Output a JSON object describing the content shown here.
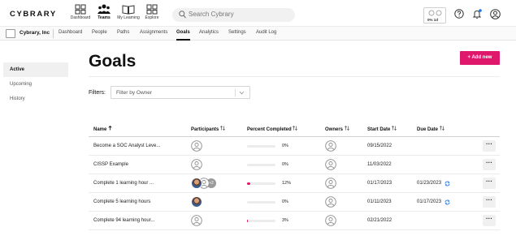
{
  "brand": {
    "logo_text": "CYBRARY",
    "accent_color": "#e0186c"
  },
  "header": {
    "nav": [
      {
        "label": "Dashboard",
        "icon": "dashboard-grid-icon",
        "active": false
      },
      {
        "label": "Teams",
        "icon": "teams-people-icon",
        "active": true
      },
      {
        "label": "My Learning",
        "icon": "book-icon",
        "active": false
      },
      {
        "label": "Explore",
        "icon": "explore-grid-icon",
        "active": false
      }
    ],
    "search": {
      "placeholder": "Search Cybrary"
    },
    "stats": {
      "text": "0% 1d"
    },
    "icons": [
      "help-icon",
      "notifications-bell-icon",
      "user-avatar-icon"
    ]
  },
  "subnav": {
    "org_name": "Cybrary, Inc",
    "tabs": [
      {
        "label": "Dashboard",
        "active": false
      },
      {
        "label": "People",
        "active": false
      },
      {
        "label": "Paths",
        "active": false
      },
      {
        "label": "Assignments",
        "active": false
      },
      {
        "label": "Goals",
        "active": true
      },
      {
        "label": "Analytics",
        "active": false
      },
      {
        "label": "Settings",
        "active": false
      },
      {
        "label": "Audit Log",
        "active": false
      }
    ]
  },
  "sidebar": {
    "items": [
      {
        "label": "Active",
        "active": true
      },
      {
        "label": "Upcoming",
        "active": false
      },
      {
        "label": "History",
        "active": false
      }
    ]
  },
  "page": {
    "title": "Goals",
    "add_button": "+ Add new",
    "filter": {
      "label": "Filters:",
      "placeholder": "Filter by Owner"
    }
  },
  "table": {
    "columns": [
      "Name",
      "Participants",
      "Percent Completed",
      "Owners",
      "Start Date",
      "Due Date"
    ],
    "rows": [
      {
        "name": "Become a SOC Analyst Leve...",
        "participants": [
          "empty"
        ],
        "percent": 0,
        "percent_text": "0%",
        "start": "09/15/2022",
        "due": "",
        "recurring": false
      },
      {
        "name": "CISSP Example",
        "participants": [
          "empty"
        ],
        "percent": 0,
        "percent_text": "0%",
        "start": "11/03/2022",
        "due": "",
        "recurring": false
      },
      {
        "name": "Complete 1 learning hour ...",
        "participants": [
          "photo",
          "empty",
          "more"
        ],
        "more_text": "+2",
        "percent": 12,
        "percent_text": "12%",
        "start": "01/17/2023",
        "due": "01/23/2023",
        "recurring": true
      },
      {
        "name": "Complete 5 learning hours",
        "participants": [
          "photo"
        ],
        "percent": 0,
        "percent_text": "0%",
        "start": "01/11/2023",
        "due": "01/17/2023",
        "recurring": true
      },
      {
        "name": "Complete 94 learning hour...",
        "participants": [
          "empty"
        ],
        "percent": 3,
        "percent_text": "3%",
        "start": "02/21/2022",
        "due": "",
        "recurring": false
      }
    ],
    "row_action_icon": "more-dots-icon",
    "sort_icons": {
      "name": "sort-ascending-arrow-icon",
      "other": "sort-toggle-icon"
    }
  }
}
